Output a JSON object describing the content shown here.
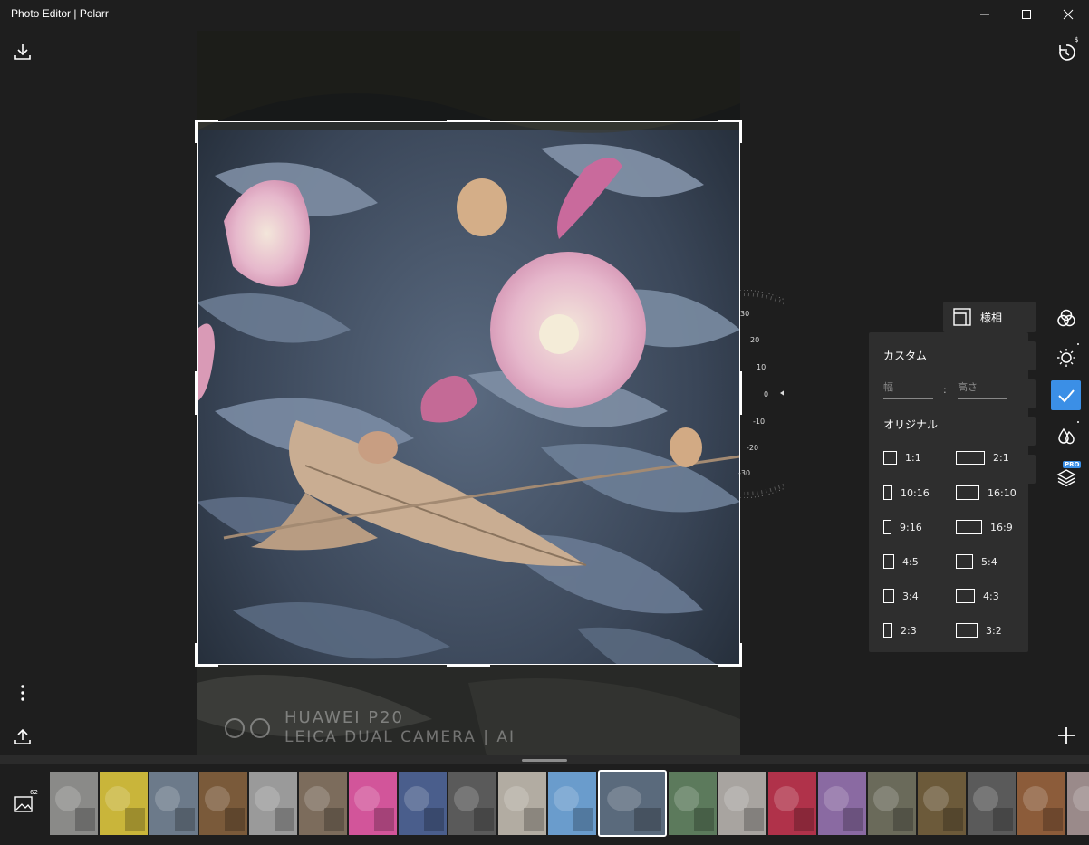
{
  "window": {
    "title": "Photo Editor | Polarr",
    "minimize_glyph": "—",
    "maximize_glyph": "☐",
    "close_glyph": "✕"
  },
  "photo": {
    "watermark_line1": "HUAWEI P20",
    "watermark_line2": "LEICA DUAL CAMERA | AI"
  },
  "toolbar_left": {
    "download_icon": "download-icon",
    "more_icon": "vertical-ellipsis-icon",
    "share_icon": "upload-icon"
  },
  "toolbar_right": {
    "history_icon": "history-icon",
    "history_badge": "$",
    "filters_icon": "overlapping-circles-icon",
    "adjust_icon": "sun-icon",
    "crop_confirm_icon": "check-icon",
    "retouch_icon": "droplets-icon",
    "layers_icon": "layers-icon",
    "pro_badge": "PRO",
    "add_icon": "plus-icon"
  },
  "rotation_dial": {
    "labels": [
      "30",
      "20",
      "10",
      "0",
      "-10",
      "-20",
      "-30"
    ],
    "current_angle": 0
  },
  "aspect_button": {
    "label": "様相"
  },
  "ratio_panel": {
    "custom_label": "カスタム",
    "width_placeholder": "幅",
    "height_placeholder": "高さ",
    "separator": ":",
    "original_label": "オリジナル",
    "ratios": [
      {
        "label": "1:1"
      },
      {
        "label": "2:1"
      },
      {
        "label": "10:16"
      },
      {
        "label": "16:10"
      },
      {
        "label": "9:16"
      },
      {
        "label": "16:9"
      },
      {
        "label": "4:5"
      },
      {
        "label": "5:4"
      },
      {
        "label": "3:4"
      },
      {
        "label": "4:3"
      },
      {
        "label": "2:3"
      },
      {
        "label": "3:2"
      }
    ]
  },
  "filmstrip": {
    "gallery_icon": "image-icon",
    "gallery_count": "62",
    "thumbnail_colors": [
      "#8a8a88",
      "#c9b53a",
      "#6c7a8a",
      "#7a5a3a",
      "#9a9a9a",
      "#7c6c5c",
      "#d2559a",
      "#4a5e8c",
      "#5a5a5a",
      "#b2aca2",
      "#6a9ccc",
      "#5a6a7c",
      "#5c7a5c",
      "#a8a4a0",
      "#b0324a",
      "#8a6aa2",
      "#6a6a5a",
      "#6c5a3a",
      "#5a5a5a",
      "#8c5c3a",
      "#9a8a8a"
    ],
    "selected_index": 11
  }
}
